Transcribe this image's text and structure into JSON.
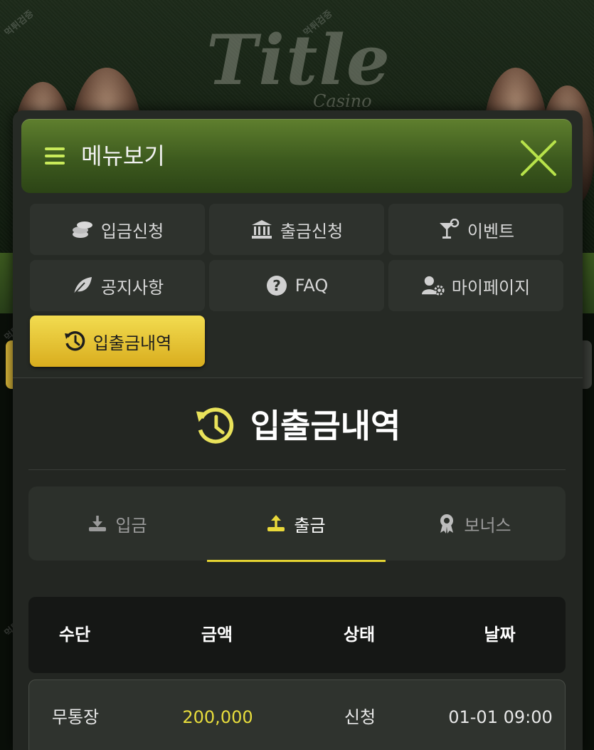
{
  "menu": {
    "title": "메뉴보기",
    "items": [
      {
        "label": "입금신청",
        "icon": "coins-icon"
      },
      {
        "label": "출금신청",
        "icon": "bank-icon"
      },
      {
        "label": "이벤트",
        "icon": "cocktail-icon"
      },
      {
        "label": "공지사항",
        "icon": "leaf-icon"
      },
      {
        "label": "FAQ",
        "icon": "question-icon"
      },
      {
        "label": "마이페이지",
        "icon": "user-gear-icon"
      },
      {
        "label": "입출금내역",
        "icon": "history-icon",
        "active": true
      }
    ]
  },
  "section": {
    "title": "입출금내역"
  },
  "tabs": [
    {
      "label": "입금",
      "icon": "download-icon"
    },
    {
      "label": "출금",
      "icon": "upload-icon",
      "active": true
    },
    {
      "label": "보너스",
      "icon": "award-icon"
    }
  ],
  "table": {
    "headers": [
      "수단",
      "금액",
      "상태",
      "날짜"
    ],
    "rows": [
      {
        "method": "무통장",
        "amount": "200,000",
        "status": "신청",
        "date": "01-01 09:00"
      }
    ]
  },
  "colors": {
    "accent": "#e3d232",
    "header_green": "#4a6b24",
    "active_yellow": "#f2dc50"
  }
}
